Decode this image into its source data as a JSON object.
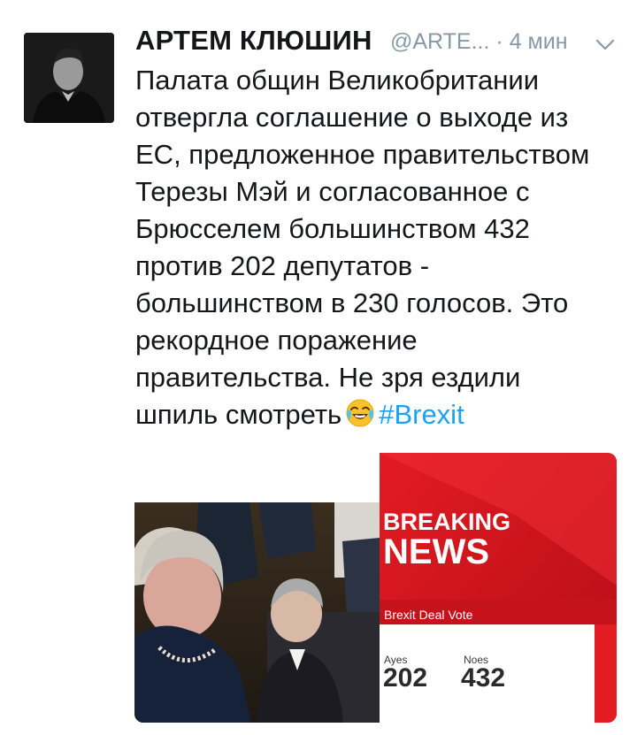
{
  "tweet": {
    "author_name": "АРТЕМ КЛЮШИН",
    "handle": "@ARTE...",
    "separator": "·",
    "timestamp": "4 мин",
    "text_lines": [
      "Палата общин Великобритании",
      "отвергла соглашение о выходе из",
      "ЕС, предложенное правительством",
      "Терезы Мэй и согласованное с",
      "Брюсселем большинством 432",
      "против 202 депутатов -",
      "большинством в 230 голосов. Это",
      "рекордное поражение",
      "правительства.  Не зря ездили",
      "шпиль смотреть"
    ],
    "emoji": "face-with-tears-of-joy",
    "hashtag": "#Brexit",
    "hashtag_color": "#1da1f2"
  },
  "media": {
    "banner_top": "BREAKING",
    "banner_bottom": "NEWS",
    "caption": "Brexit Deal Vote",
    "ayes_label": "Ayes",
    "ayes_value": "202",
    "noes_label": "Noes",
    "noes_value": "432",
    "accent_color": "#d7121f"
  }
}
